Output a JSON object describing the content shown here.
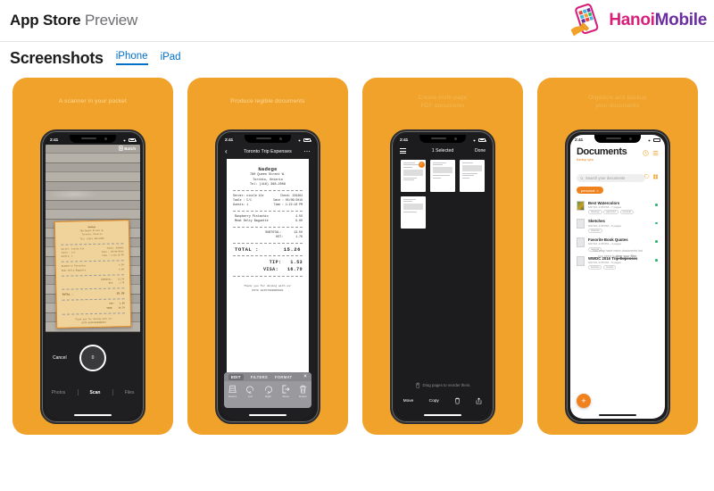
{
  "header": {
    "title_bold": "App Store",
    "title_light": "Preview",
    "brand_hanoi": "Hanoi",
    "brand_mobile": "Mobile",
    "brand_icon": "phone-wrench-icon"
  },
  "screenshots_section": {
    "heading": "Screenshots",
    "tabs": [
      {
        "label": "iPhone",
        "active": true
      },
      {
        "label": "iPad",
        "active": false
      }
    ]
  },
  "shots": [
    {
      "caption": "A scanner in your pocket",
      "status": {
        "time": "2:41"
      },
      "batch_label": "Batch",
      "cancel_label": "Cancel",
      "shutter_count": "0",
      "modes": [
        "Photos",
        "Scan",
        "Files"
      ],
      "active_mode": "Scan",
      "receipt": {
        "business": "Nadege",
        "address1": "780 Queen Street W.",
        "address2": "Toronto, Ontario",
        "tel": "Tel: (416) 368-2009",
        "server": "Server: nicole kle",
        "check": "Check: 229464",
        "table": "Table : C/C",
        "date": "Date : 05/06/2016",
        "guests": "Guests: 1",
        "time": "Time : 1:22:18 PM",
        "item1_qty": "1",
        "item1_name": "Raspberry Pistachio",
        "item1_price": "4.50",
        "item2_qty": "1",
        "item2_name": "Meat Delty Baguette",
        "item2_price": "9.00",
        "subtotal_label": "SUBTOTAL:",
        "subtotal_value": "13.50",
        "hst_label": "HST:",
        "hst_value": "1.76",
        "total_label": "TOTAL :",
        "total_value": "15.26",
        "tip_label": "TIP:",
        "tip_value": "1.53",
        "visa_label": "VISA:",
        "visa_value": "16.79",
        "thanks": "Thank you for dining with us!",
        "footer_code": "HST# 824579890R0001"
      }
    },
    {
      "caption": "Produce legible documents",
      "status": {
        "time": "2:41"
      },
      "nav_title": "Toronto Trip Expenses",
      "back_icon": "chevron-left-icon",
      "more_icon": "more-dots-icon",
      "edit_tabs": [
        "EDIT",
        "FILTERS",
        "FORMAT"
      ],
      "active_edit_tab": "EDIT",
      "close_icon": "close-icon",
      "tools": [
        {
          "label": "Resize",
          "icon": "crop-icon"
        },
        {
          "label": "Left",
          "icon": "rotate-left-icon"
        },
        {
          "label": "Right",
          "icon": "rotate-right-icon"
        },
        {
          "label": "Move",
          "icon": "move-out-icon"
        },
        {
          "label": "Delete",
          "icon": "trash-icon"
        }
      ]
    },
    {
      "caption_line1": "Create multi-page",
      "caption_line2": "PDF documents",
      "status": {
        "time": "2:41"
      },
      "nav_title": "1 Selected",
      "done_label": "Done",
      "list_icon": "list-view-icon",
      "hint": "Drag pages to reorder them.",
      "hint_icon": "drag-hand-icon",
      "actions": [
        {
          "label": "Move",
          "icon": "move-icon"
        },
        {
          "label": "Copy",
          "icon": "copy-icon"
        },
        {
          "label": "",
          "icon": "trash-icon"
        },
        {
          "label": "",
          "icon": "share-icon"
        }
      ]
    },
    {
      "caption_line1": "Organize and backup",
      "caption_line2": "your documents",
      "status": {
        "time": "2:41"
      },
      "title": "Documents",
      "subtitle": "Backup sync",
      "header_icons": [
        "clock-icon",
        "list-toggle-icon"
      ],
      "search_placeholder": "Search your documents",
      "search_icon": "search-icon",
      "trailing_icons": [
        "tag-icon",
        "filter-icon"
      ],
      "filter_chip": {
        "label": "personal",
        "close_icon": "chip-close-icon"
      },
      "documents": [
        {
          "name": "Best Watercolors",
          "meta": "6/27/16, 2:05 PM – 7 pages",
          "tags": [
            "drawings",
            "watercolor",
            "personal"
          ],
          "thumb": "artwork-thumb",
          "status_dot": "#2bb673"
        },
        {
          "name": "Sketches",
          "meta": "6/27/16, 2:05 PM – 5 pages",
          "tags": [
            "drawings"
          ],
          "thumb": "sketch-thumb",
          "status_dot": "#2bb673"
        },
        {
          "name": "Favorite Book Quotes",
          "meta": "6/27/16, 2:05 PM – 4 pages",
          "tags": [
            "personal"
          ],
          "thumb": "text-thumb",
          "status_dot": "#2bb673"
        },
        {
          "name": "WWDC 2016 Trip Expenses",
          "meta": "6/27/16, 2:05 PM – 5 pages",
          "tags": [
            "business",
            "receipts"
          ],
          "thumb": "receipt-thumb",
          "status_dot": "#2bb673"
        }
      ],
      "empty_line1": "You may have more documents but",
      "empty_line2_pre": "you need to ",
      "empty_line2_link": "clear your filter",
      "empty_line2_post": ".",
      "fab_icon": "plus-icon"
    }
  ],
  "colors": {
    "card_orange": "#f0a22b",
    "accent_orange": "#f0821e",
    "link_blue": "#0070c9",
    "brand_pink": "#d81f7a",
    "brand_purple": "#6b2fa0",
    "status_green": "#2bb673"
  }
}
